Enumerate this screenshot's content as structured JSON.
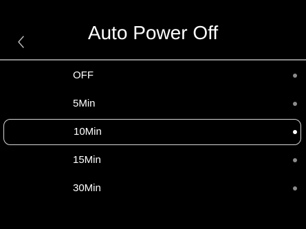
{
  "header": {
    "title": "Auto Power Off",
    "back_icon": "chevron-left-icon"
  },
  "options": [
    {
      "label": "OFF",
      "selected": false
    },
    {
      "label": "5Min",
      "selected": false
    },
    {
      "label": "10Min",
      "selected": true
    },
    {
      "label": "15Min",
      "selected": false
    },
    {
      "label": "30Min",
      "selected": false
    }
  ],
  "colors": {
    "background": "#000000",
    "text": "#ffffff",
    "divider": "#8a8a8a",
    "dot_inactive": "#8c8c8c",
    "dot_active": "#ffffff",
    "selection_border": "#d8d8d8"
  }
}
